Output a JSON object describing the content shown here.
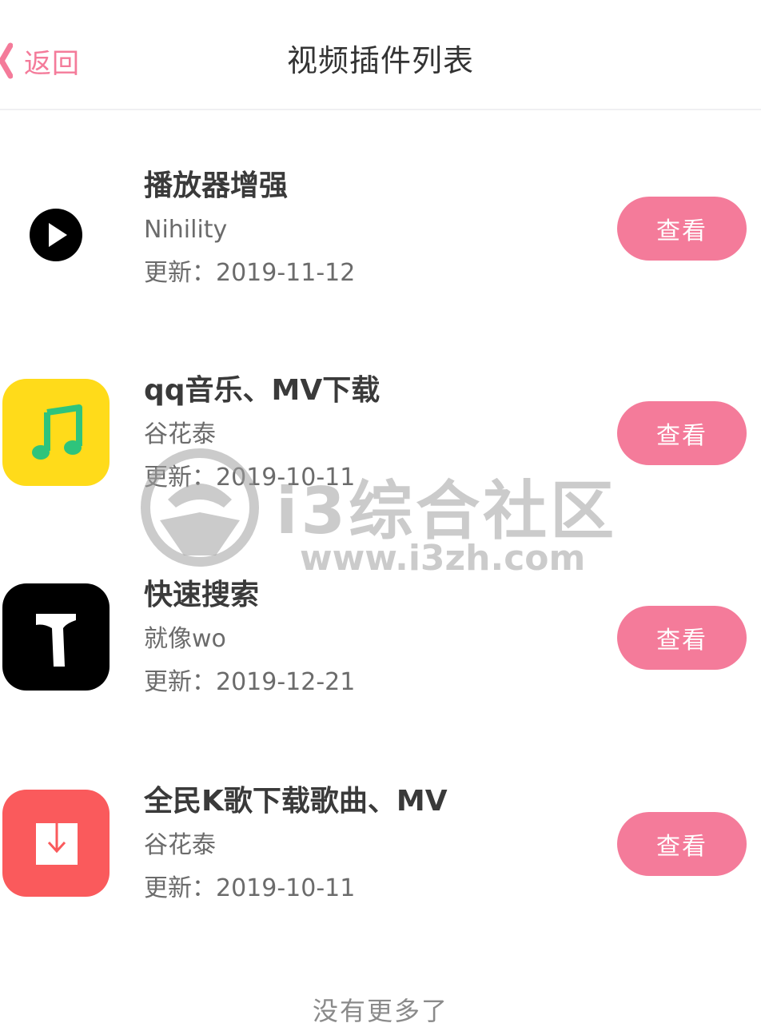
{
  "header": {
    "back_label": "返回",
    "title": "视频插件列表"
  },
  "plugins": [
    {
      "name": "播放器增强",
      "author": "Nihility",
      "updated": "更新：2019-11-12",
      "action": "查看",
      "icon": "play-circle-icon",
      "icon_bg": "#ffffff"
    },
    {
      "name": "qq音乐、MV下载",
      "author": "谷花泰",
      "updated": "更新：2019-10-11",
      "action": "查看",
      "icon": "music-note-icon",
      "icon_bg": "#ffdb1a"
    },
    {
      "name": "快速搜索",
      "author": "就像wo",
      "updated": "更新：2019-12-21",
      "action": "查看",
      "icon": "hammer-icon",
      "icon_bg": "#000000"
    },
    {
      "name": "全民K歌下载歌曲、MV",
      "author": "谷花泰",
      "updated": "更新：2019-10-11",
      "action": "查看",
      "icon": "download-icon",
      "icon_bg": "#fa5a5c"
    }
  ],
  "footer": {
    "text": "没有更多了"
  },
  "watermark": {
    "brand": "i3综合社区",
    "url": "www.i3zh.com"
  },
  "colors": {
    "accent": "#f47b9a",
    "title_text": "#333333",
    "secondary_text": "#6b6b6b"
  }
}
